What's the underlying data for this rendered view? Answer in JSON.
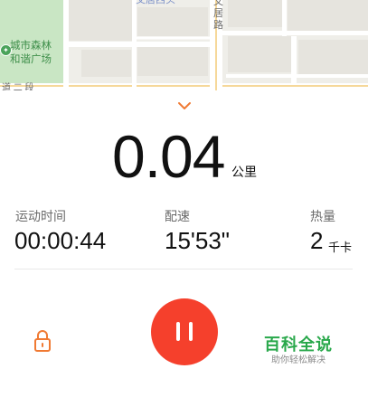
{
  "map": {
    "park_label": "城市森林和谐广场",
    "road_top_label": "交居西头",
    "road_vertical_label": "文居路",
    "road_bottom_label": "道  二  段"
  },
  "run": {
    "distance_value": "0.04",
    "distance_unit": "公里",
    "stats": [
      {
        "label": "运动时间",
        "value": "00:00:44",
        "unit": ""
      },
      {
        "label": "配速",
        "value": "15'53\"",
        "unit": ""
      },
      {
        "label": "热量",
        "value": "2",
        "unit": "千卡"
      }
    ]
  },
  "controls": {
    "collapse_icon": "chevron-down-icon",
    "lock_icon": "lock-icon",
    "pause_icon": "pause-icon"
  },
  "watermark": {
    "title": "百科全说",
    "subtitle": "助你轻松解决"
  },
  "colors": {
    "accent": "#f5402c",
    "chevron": "#f07a33",
    "lock": "#f07a33",
    "park": "#c9e6c4",
    "map_bg": "#efeee9",
    "watermark_green": "#29a84b"
  }
}
